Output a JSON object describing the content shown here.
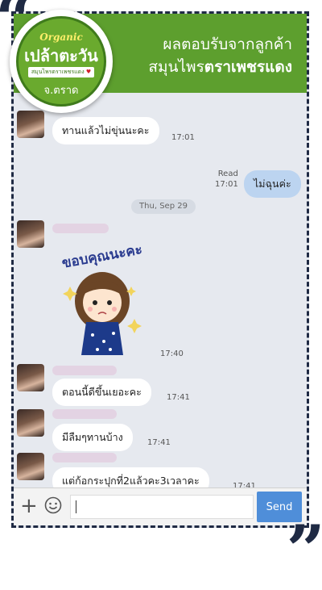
{
  "banner": {
    "line1": "ผลตอบรับจากลูกค้า",
    "line2_regular": "สมุนไพร",
    "line2_bold": "ตราเพชรแดง"
  },
  "logo": {
    "organic": "Organic",
    "brand": "เปล้าตะวัน",
    "subtitle": "สมุนไพรตราเพชรแดง",
    "place": "จ.ตราด"
  },
  "messages": [
    {
      "sender": "them",
      "text": "ทานแล้วไม่ขุ่นนะคะ",
      "time": "17:01"
    },
    {
      "sender": "me",
      "text": "ไม่ฉุนค่ะ",
      "status": "Read",
      "time": "17:01"
    },
    {
      "sender": "them",
      "kind": "sticker",
      "sticker_text": "ขอบคุณนะคะ",
      "time": "17:40"
    },
    {
      "sender": "them",
      "text": "ตอนนี้ดีขึ้นเยอะคะ",
      "time": "17:41"
    },
    {
      "sender": "them",
      "text": "มีลืมๆทานบ้าง",
      "time": "17:41"
    },
    {
      "sender": "them",
      "text": "แต่ก้อกระปุกที่2แล้วคะ3เวลาคะ",
      "time": "17:41"
    }
  ],
  "date_separator": "Thu, Sep 29",
  "input": {
    "plus_icon": "plus-icon",
    "emoji_icon": "emoji-icon",
    "placeholder": "",
    "send_label": "Send"
  },
  "colors": {
    "banner_green": "#5d9f2e",
    "frame_dash": "#1f2a44",
    "my_bubble": "#bcd4f0",
    "send_button": "#4f8ed9"
  }
}
